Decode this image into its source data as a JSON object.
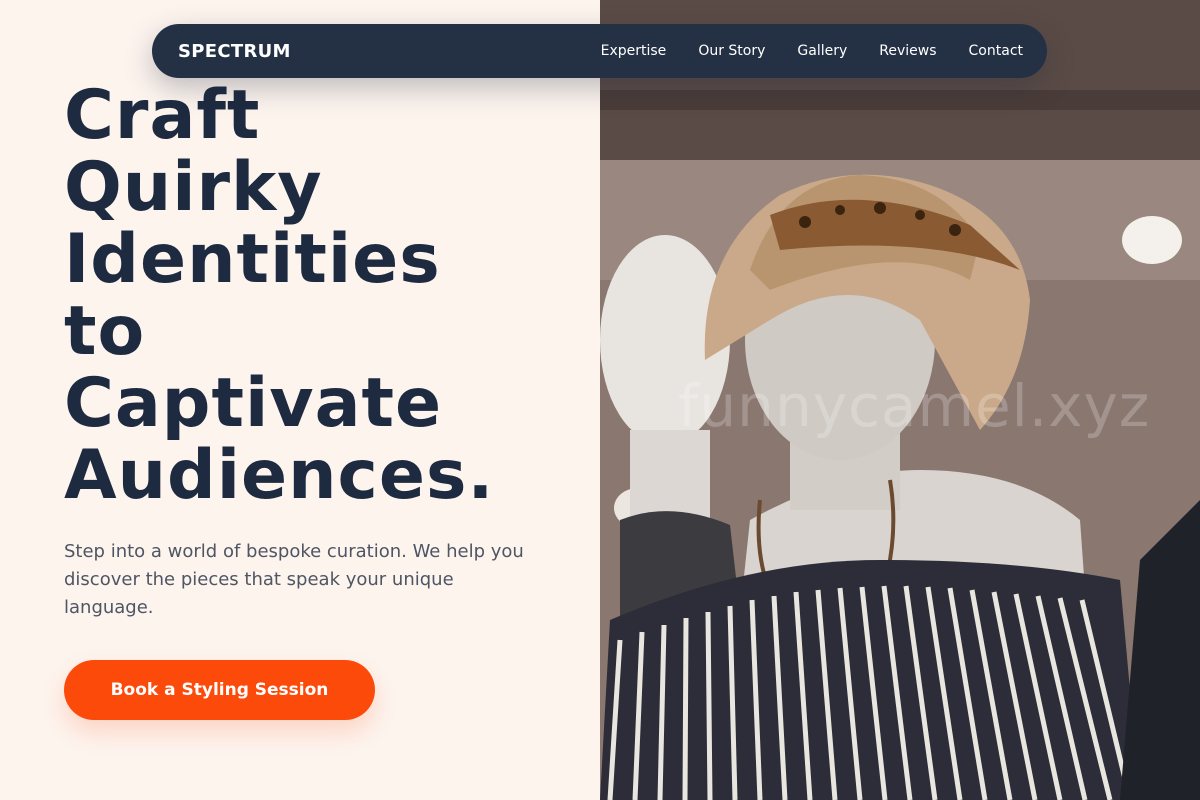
{
  "brand": {
    "name": "SPECTRUM"
  },
  "nav": {
    "items": [
      {
        "label": "Expertise"
      },
      {
        "label": "Our Story"
      },
      {
        "label": "Gallery"
      },
      {
        "label": "Reviews"
      },
      {
        "label": "Contact"
      }
    ]
  },
  "hero": {
    "headline_lines": [
      "Craft",
      "Quirky",
      "Identities",
      "to",
      "Captivate",
      "Audiences."
    ],
    "description": "Step into a world of bespoke curation. We help you discover the pieces that speak your unique language.",
    "cta_label": "Book a Styling Session"
  },
  "image": {
    "alt": "Mannequins wearing a straw hat with leopard-print scarf, a wooden bead necklace and a striped off-shoulder top",
    "watermark": "funnycamel.xyz"
  },
  "colors": {
    "navbar_bg": "#243044",
    "headline": "#1d2a40",
    "accent": "#fc4a0a",
    "page_bg": "#fdf4ee"
  }
}
